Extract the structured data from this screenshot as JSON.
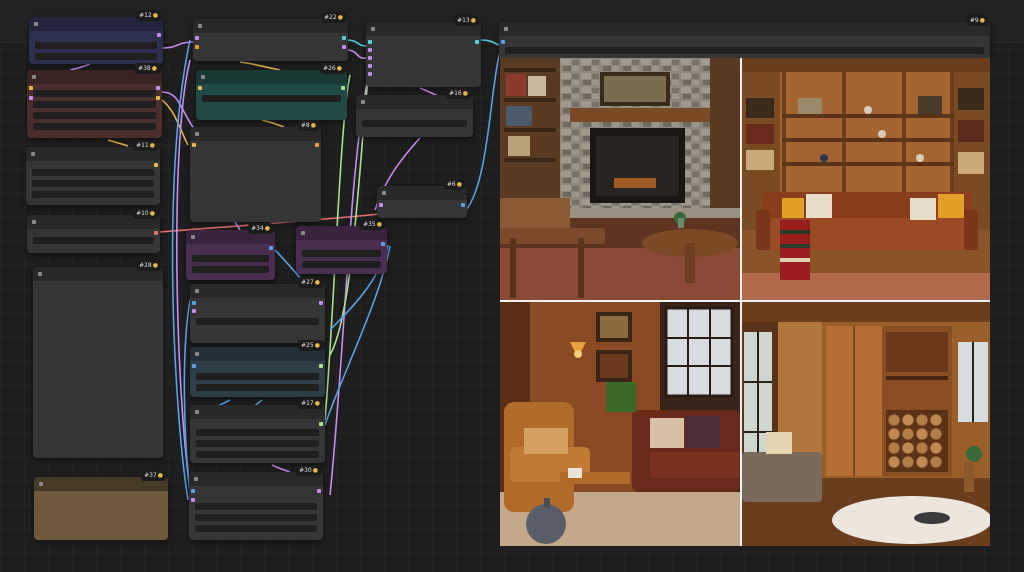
{
  "colors": {
    "canvas": "#1e1e1e",
    "node_default": "#353535",
    "node_blue": "#2e3050",
    "node_red": "#4a2e2e",
    "node_teal": "#224a45",
    "node_purple": "#4a2e50",
    "node_slate": "#2e3e48",
    "node_tan": "#6e5a3a",
    "wire_yellow": "#e6b84a",
    "wire_purple": "#c58cf0",
    "wire_blue": "#5aa0e6",
    "wire_green": "#a8e08c",
    "wire_red": "#e6706e",
    "wire_cyan": "#4fd1d9",
    "wire_orange": "#e6a23c"
  },
  "badge_icon": "lock-icon",
  "nodes": [
    {
      "id": "#12",
      "color": "blue"
    },
    {
      "id": "#38",
      "color": "red"
    },
    {
      "id": "#11",
      "color": "default"
    },
    {
      "id": "#10",
      "color": "default"
    },
    {
      "id": "#28",
      "color": "default"
    },
    {
      "id": "#37",
      "color": "tan"
    },
    {
      "id": "#22",
      "color": "default"
    },
    {
      "id": "#26",
      "color": "teal"
    },
    {
      "id": "#8",
      "color": "default"
    },
    {
      "id": "#34",
      "color": "purple"
    },
    {
      "id": "#35",
      "color": "purple"
    },
    {
      "id": "#27",
      "color": "default"
    },
    {
      "id": "#25",
      "color": "slate"
    },
    {
      "id": "#17",
      "color": "default"
    },
    {
      "id": "#30",
      "color": "default"
    },
    {
      "id": "#13",
      "color": "default"
    },
    {
      "id": "#16",
      "color": "default"
    },
    {
      "id": "#6",
      "color": "default"
    },
    {
      "id": "#9",
      "color": "default"
    }
  ],
  "preview": {
    "images": [
      {
        "subject": "rustic living room with stone fireplace, bookshelves, armchair and round wooden coffee table"
      },
      {
        "subject": "wood-paneled library with tall bookshelves, brown leather sofa and plaid throw"
      },
      {
        "subject": "warm room with leather armchair, brown leather sofa, pendant lamp and large window"
      },
      {
        "subject": "wooden cabin room with built-in cabinets, stacked firewood, daybed and fur rug"
      }
    ]
  }
}
